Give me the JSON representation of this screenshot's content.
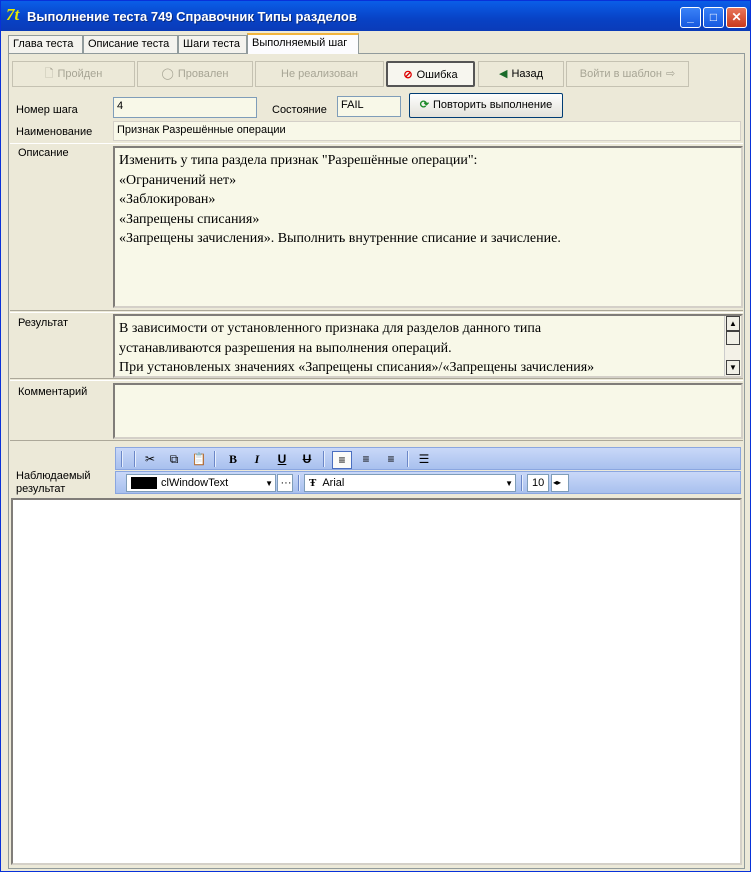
{
  "window": {
    "title": "Выполнение теста 749 Справочник Типы разделов",
    "app_icon": "7t-logo"
  },
  "tabs": [
    {
      "label": "Глава теста"
    },
    {
      "label": "Описание теста"
    },
    {
      "label": "Шаги теста"
    },
    {
      "label": "Выполняемый шаг",
      "active": true
    }
  ],
  "actions": {
    "passed": "Пройден",
    "failed": "Провален",
    "not_implemented": "Не реализован",
    "error": "Ошибка",
    "back": "Назад",
    "enter_template": "Войти в шаблон"
  },
  "step": {
    "number_label": "Номер шага",
    "number_value": "4",
    "state_label": "Состояние",
    "state_value": "FAIL",
    "repeat_button": "Повторить выполнение",
    "name_label": "Наименование",
    "name_value": "Признак Разрешённые операции"
  },
  "description": {
    "label": "Описание",
    "lines": [
      "Изменить у типа раздела признак \"Разрешённые операции\":",
      "«Ограничений нет»",
      "«Заблокирован»",
      "«Запрещены списания»",
      "«Запрещены зачисления». Выполнить внутренние списание и зачисление."
    ]
  },
  "result": {
    "label": "Результат",
    "lines": [
      "В зависимости от установленного признака для разделов данного типа",
      "устанавливаются разрешения на выполнения операций.",
      "При установленых значениях «Запрещены списания»/«Запрещены зачисления»"
    ]
  },
  "comment": {
    "label": "Комментарий",
    "value": ""
  },
  "observed": {
    "label": "Наблюдаемый результат",
    "color_value": "clWindowText",
    "font_value": "Arial",
    "size_value": "10"
  }
}
